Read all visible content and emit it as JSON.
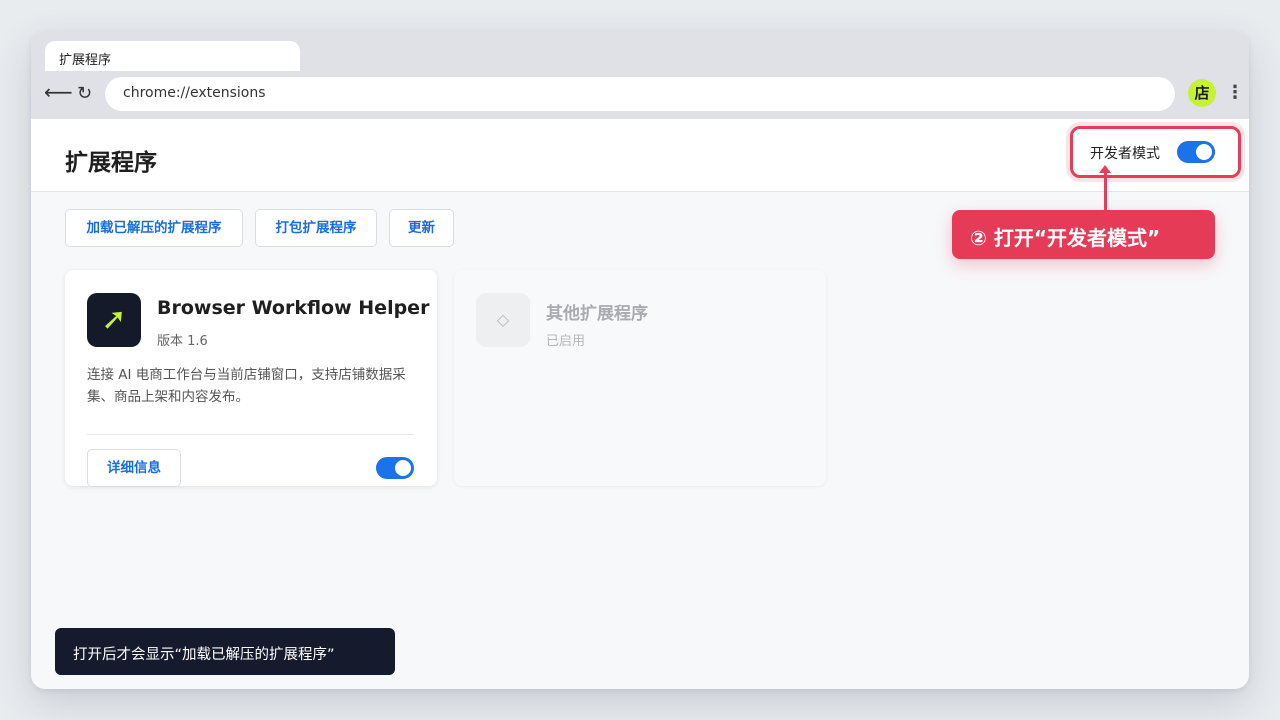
{
  "browser": {
    "tab_title": "扩展程序",
    "address": "chrome://extensions",
    "profile_initial": "店",
    "back_glyph": "⟵",
    "reload_glyph": "↻",
    "menu_glyph": "⋮"
  },
  "page": {
    "title": "扩展程序",
    "dev_mode_label": "开发者模式",
    "dev_mode_on": true
  },
  "toolbar": {
    "load_unpacked": "加载已解压的扩展程序",
    "pack": "打包扩展程序",
    "update": "更新"
  },
  "callout": {
    "text": "② 打开“开发者模式”",
    "color": "#e63b57"
  },
  "extensions": [
    {
      "name": "Browser Workflow Helper",
      "version": "版本 1.6",
      "description": "连接 AI 电商工作台与当前店铺窗口，支持店铺数据采集、商品上架和内容发布。",
      "details_label": "详细信息",
      "enabled": true,
      "icon": "arrow-up-right-icon",
      "icon_glyph": "➚"
    },
    {
      "name": "其他扩展程序",
      "status": "已启用",
      "icon": "diamond-icon",
      "icon_glyph": "◇"
    }
  ],
  "hint": {
    "text": "打开后才会显示“加载已解压的扩展程序”"
  },
  "colors": {
    "accent": "#1a73e8",
    "highlight": "#e43f5a",
    "brand_icon_bg": "#141a2a",
    "brand_icon_fg": "#c6f135"
  }
}
